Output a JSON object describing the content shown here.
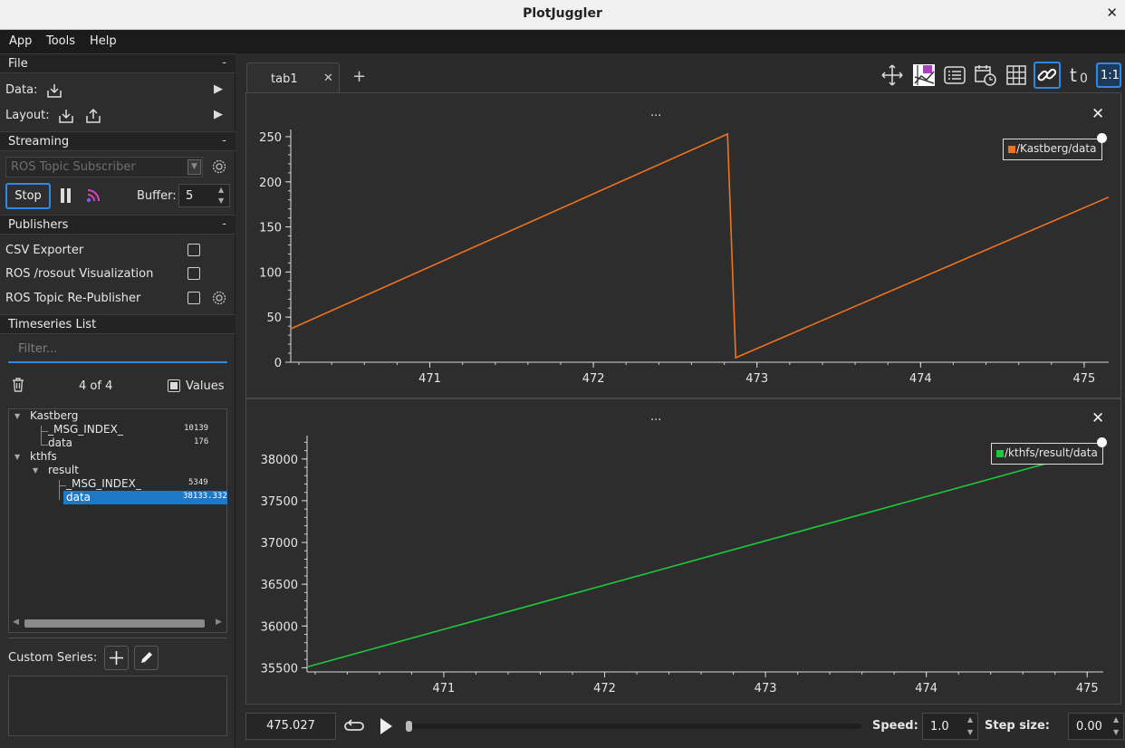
{
  "window": {
    "title": "PlotJuggler"
  },
  "menu": [
    "App",
    "Tools",
    "Help"
  ],
  "file_section": {
    "header": "File",
    "collapse": "-",
    "data_label": "Data:",
    "layout_label": "Layout:"
  },
  "streaming_section": {
    "header": "Streaming",
    "collapse": "-",
    "source_placeholder": "ROS Topic Subscriber",
    "stop_label": "Stop",
    "buffer_label": "Buffer:",
    "buffer_value": "5"
  },
  "publishers_section": {
    "header": "Publishers",
    "collapse": "-",
    "items": [
      {
        "label": "CSV Exporter",
        "checked": false
      },
      {
        "label": "ROS /rosout Visualization",
        "checked": false
      },
      {
        "label": "ROS Topic Re-Publisher",
        "checked": false
      }
    ]
  },
  "timeseries_section": {
    "header": "Timeseries List",
    "filter_placeholder": "Filter...",
    "count": "4 of 4",
    "values_label": "Values",
    "values_checked": true,
    "tree": [
      {
        "name": "Kastberg",
        "value": ""
      },
      {
        "name": "_MSG_INDEX_",
        "value": "10139"
      },
      {
        "name": "data",
        "value": "176"
      },
      {
        "name": "kthfs",
        "value": ""
      },
      {
        "name": "result",
        "value": ""
      },
      {
        "name": "_MSG_INDEX_",
        "value": "5349"
      },
      {
        "name": "data",
        "value": "38133.332"
      }
    ],
    "custom_series_label": "Custom Series:"
  },
  "tabs": [
    {
      "label": "tab1"
    }
  ],
  "add_tab": "+",
  "toolbar_icons": [
    "move-icon",
    "legend-toggle-icon",
    "list-icon",
    "time-format-icon",
    "grid-icon",
    "link-axes-icon",
    "time-offset-icon",
    "ratio-icon"
  ],
  "toolbar": {
    "t0_label": "t",
    "t0_sub": "0",
    "ratio_label": "1:1"
  },
  "plots": [
    {
      "menu_dots": "...",
      "legend": "/Kastberg/data"
    },
    {
      "menu_dots": "...",
      "legend": "/kthfs/result/data"
    }
  ],
  "colors": {
    "series1": "#f0721e",
    "series2": "#1ec83c",
    "accent": "#2e8ae6",
    "selection": "#1e78c8"
  },
  "chart_data": [
    {
      "type": "line",
      "title": "",
      "xlabel": "",
      "ylabel": "",
      "xlim": [
        470.15,
        475.15
      ],
      "ylim": [
        0,
        258
      ],
      "xticks": [
        471,
        472,
        473,
        474,
        475
      ],
      "yticks": [
        0,
        50,
        100,
        150,
        200,
        250
      ],
      "grid": false,
      "legend_position": "top-right",
      "series": [
        {
          "name": "/Kastberg/data",
          "x": [
            470.15,
            472.82,
            472.87,
            475.15
          ],
          "y": [
            37,
            253,
            5,
            183
          ]
        }
      ]
    },
    {
      "type": "line",
      "title": "",
      "xlabel": "",
      "ylabel": "",
      "xlim": [
        470.15,
        475.1
      ],
      "ylim": [
        35450,
        38280
      ],
      "xticks": [
        471,
        472,
        473,
        474,
        475
      ],
      "yticks": [
        35500,
        36000,
        36500,
        37000,
        37500,
        38000
      ],
      "grid": false,
      "legend_position": "top-right",
      "series": [
        {
          "name": "/kthfs/result/data",
          "x": [
            470.15,
            475.1
          ],
          "y": [
            35510,
            38133
          ]
        }
      ]
    }
  ],
  "bottom": {
    "time_value": "475.027",
    "speed_label": "Speed:",
    "speed_value": "1.0",
    "step_label": "Step size:",
    "step_value": "0.00"
  }
}
